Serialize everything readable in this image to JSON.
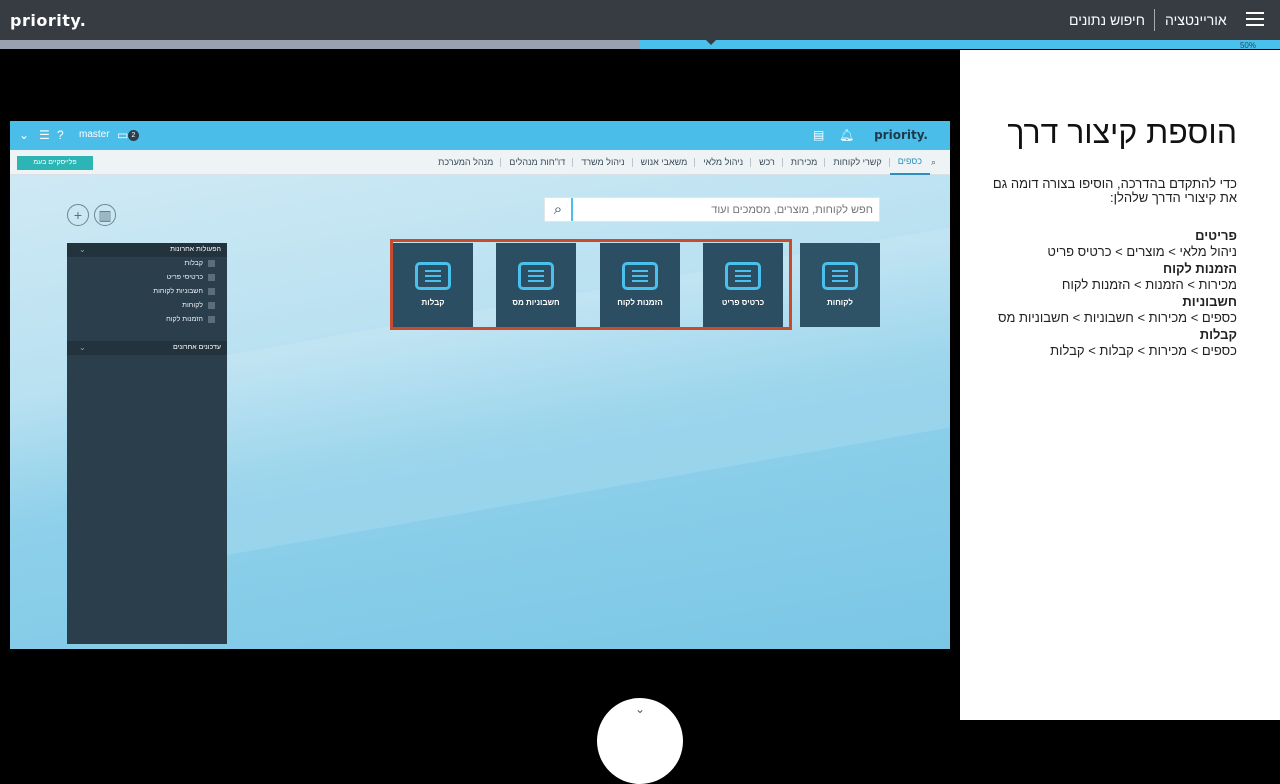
{
  "topbar": {
    "logo": "priority.",
    "nav_orientation": "אוריינטציה",
    "nav_data_search": "חיפוש נתונים",
    "progress_percent": 50,
    "progress_label": "50%"
  },
  "app": {
    "logo": "priority.",
    "user": "master",
    "badge_count": "2",
    "menu_items": [
      "כספים",
      "קשרי לקוחות",
      "מכירות",
      "רכש",
      "ניהול מלאי",
      "משאבי אנוש",
      "ניהול משרד",
      "דו\"חות מנהלים",
      "מנהל המערכת"
    ],
    "active_menu": "כספים",
    "green_button": "פלייסקיים בעמ",
    "search_placeholder": "חפש לקוחות, מוצרים, מסמכים ועוד",
    "side_panel": {
      "recent_actions_title": "הפעולות אחרונות",
      "recent_actions": [
        "קבלות",
        "כרטיסי פריט",
        "חשבוניות לקוחות",
        "לקוחות",
        "הזמנות לקוח"
      ],
      "recent_updates_title": "עדכונים אחרונים"
    },
    "tiles": [
      {
        "label": "לקוחות"
      },
      {
        "label": "כרטיס פריט"
      },
      {
        "label": "הזמנות לקוח"
      },
      {
        "label": "חשבוניות מס"
      },
      {
        "label": "קבלות"
      }
    ]
  },
  "instructions": {
    "title": "הוספת קיצור דרך",
    "intro": "כדי להתקדם בהדרכה, הוסיפו בצורה דומה גם את קיצורי הדרך שלהלן:",
    "items": [
      {
        "heading": "פריטים",
        "path": "ניהול מלאי > מוצרים > כרטיס פריט"
      },
      {
        "heading": "הזמנות לקוח",
        "path": "מכירות > הזמנות > הזמנות לקוח"
      },
      {
        "heading": "חשבוניות",
        "path": "כספים > מכירות > חשבוניות > חשבוניות מס"
      },
      {
        "heading": "קבלות",
        "path": "כספים > מכירות > קבלות > קבלות"
      }
    ]
  },
  "colors": {
    "accent": "#49c1ec",
    "dark": "#363c42",
    "tile": "#2b4e62",
    "highlight": "#c94b2d"
  }
}
